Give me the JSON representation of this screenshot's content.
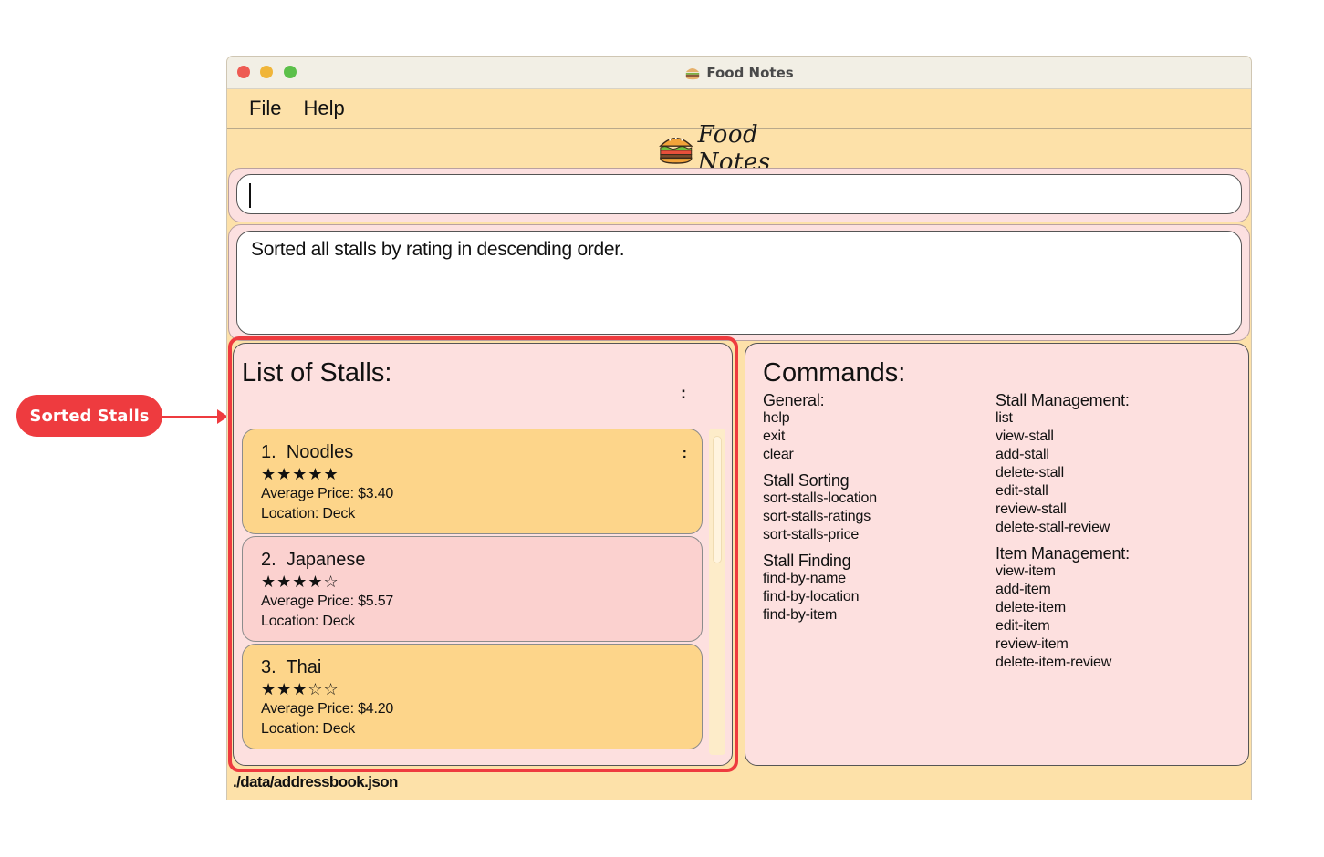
{
  "callout": {
    "label": "Sorted Stalls"
  },
  "window": {
    "title": "Food Notes"
  },
  "menu": {
    "items": [
      "File",
      "Help"
    ]
  },
  "logo": {
    "text": "Food Notes"
  },
  "command_box": {
    "value": "",
    "placeholder": ""
  },
  "result": {
    "text": "Sorted all stalls by rating in descending order."
  },
  "stalls": {
    "title": "List of Stalls:",
    "items": [
      {
        "index": "1.",
        "name": "Noodles",
        "rating": 5,
        "stars": "★★★★★",
        "price": "Average Price: $3.40",
        "location": "Location: Deck"
      },
      {
        "index": "2.",
        "name": "Japanese",
        "rating": 4,
        "stars": "★★★★☆",
        "price": "Average Price: $5.57",
        "location": "Location: Deck"
      },
      {
        "index": "3.",
        "name": "Thai",
        "rating": 3,
        "stars": "★★★☆☆",
        "price": "Average Price: $4.20",
        "location": "Location: Deck"
      }
    ]
  },
  "commands": {
    "title": "Commands:",
    "general": {
      "heading": "General:",
      "items": [
        "help",
        "exit",
        "clear"
      ]
    },
    "stall_sorting": {
      "heading": "Stall Sorting",
      "items": [
        "sort-stalls-location",
        "sort-stalls-ratings",
        "sort-stalls-price"
      ]
    },
    "stall_finding": {
      "heading": "Stall Finding",
      "items": [
        "find-by-name",
        "find-by-location",
        "find-by-item"
      ]
    },
    "stall_management": {
      "heading": "Stall Management:",
      "items": [
        "list",
        "view-stall",
        "add-stall",
        "delete-stall",
        "edit-stall",
        "review-stall",
        "delete-stall-review"
      ]
    },
    "item_management": {
      "heading": "Item Management:",
      "items": [
        "view-item",
        "add-item",
        "delete-item",
        "edit-item",
        "review-item",
        "delete-item-review"
      ]
    }
  },
  "status": {
    "path": "./data/addressbook.json"
  },
  "colors": {
    "window_bg": "#fde1a9",
    "panel_bg": "#fde0df",
    "card_gold": "#fdd58a",
    "card_rose": "#fbd1cf",
    "highlight": "#ee3b3f"
  }
}
